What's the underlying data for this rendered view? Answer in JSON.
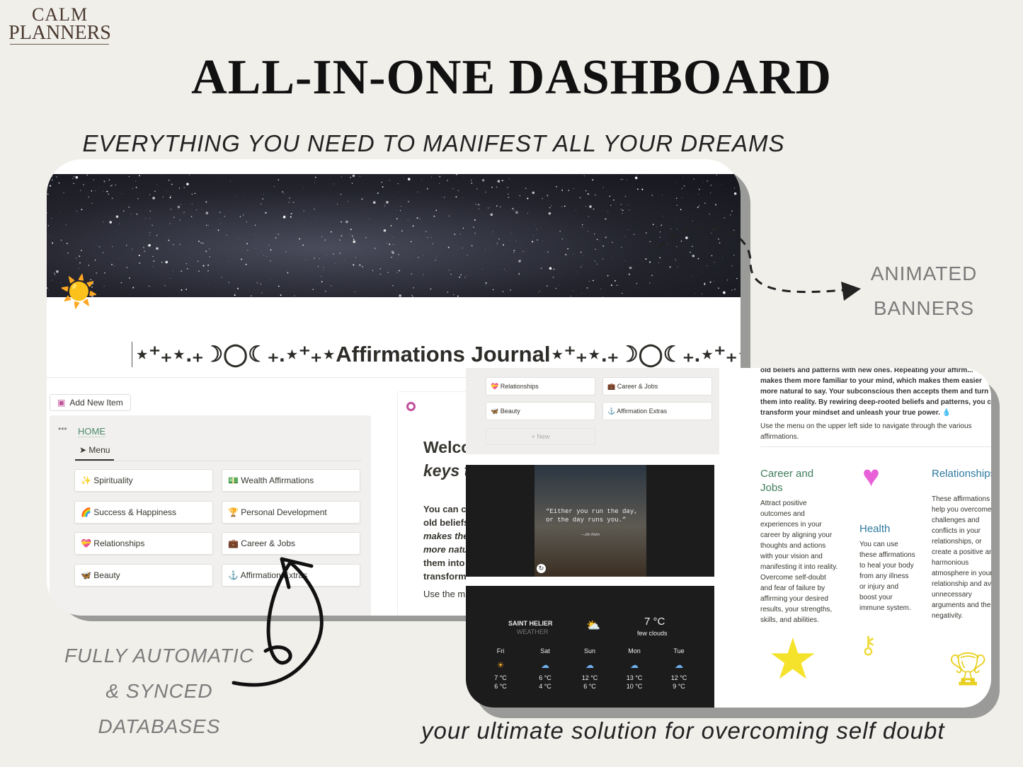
{
  "brand": {
    "line1": "CALM",
    "line2": "PLANNERS"
  },
  "header": {
    "title": "ALL-IN-ONE DASHBOARD",
    "subtitle": "EVERYTHING YOU NEED TO MANIFEST ALL YOUR DREAMS"
  },
  "annotations": {
    "animated_line1": "ANIMATED",
    "animated_line2": "BANNERS",
    "auto_line1": "FULLY AUTOMATIC",
    "auto_line2": "& SYNCED",
    "auto_line3": "DATABASES",
    "tagline": "your ultimate solution for overcoming self doubt"
  },
  "page": {
    "icon": "☀️",
    "title": "⋆⁺₊⋆.₊☽◯☾₊.⋆⁺₊⋆Affirmations Journal⋆⁺₊⋆.₊☽◯☾₊.⋆⁺₊⋆",
    "add_new_label": "Add New Item",
    "home_label": "HOME",
    "menu_tab": "Menu"
  },
  "menu": {
    "items": [
      {
        "icon": "✨",
        "label": "Spirituality"
      },
      {
        "icon": "💵",
        "label": "Wealth Affirmations"
      },
      {
        "icon": "🌈",
        "label": "Success & Happiness"
      },
      {
        "icon": "🏆",
        "label": "Personal Development"
      },
      {
        "icon": "💝",
        "label": "Relationships"
      },
      {
        "icon": "💼",
        "label": "Career & Jobs"
      },
      {
        "icon": "🦋",
        "label": "Beauty"
      },
      {
        "icon": "⚓",
        "label": "Affirmation Extras"
      }
    ],
    "new_label": "+ New"
  },
  "welcome": {
    "heading1": "Welco",
    "heading2": "keys t",
    "lines": [
      "You can c",
      "old beliefs",
      "makes the",
      "more natu",
      "them into",
      "transform",
      "Use the m"
    ]
  },
  "video": {
    "quote": "“Either you run the day, or the day runs you.”",
    "author": "—Jim Rohn"
  },
  "weather": {
    "city": "SAINT HELIER",
    "label": "WEATHER",
    "current_temp": "7 °C",
    "description": "few clouds",
    "icon": "sun-cloud",
    "forecast": [
      {
        "day": "Fri",
        "icon": "☀",
        "high": "7 °C",
        "low": "6 °C"
      },
      {
        "day": "Sat",
        "icon": "☁",
        "high": "6 °C",
        "low": "4 °C"
      },
      {
        "day": "Sun",
        "icon": "☁",
        "high": "12 °C",
        "low": "6 °C"
      },
      {
        "day": "Mon",
        "icon": "☁",
        "high": "13 °C",
        "low": "10 °C"
      },
      {
        "day": "Tue",
        "icon": "☁",
        "high": "12 °C",
        "low": "9 °C"
      }
    ]
  },
  "intro": {
    "p1": "old beliefs and patterns with new ones. Repeating your affirm... makes them more familiar to your mind, which makes them easier more natural to say. Your subconscious then accepts them and turn them into reality. By rewiring deep-rooted beliefs and patterns, you c transform your mindset and unleash your true power. 💧",
    "p2": "Use the menu on the upper left side to navigate through the various affirmations."
  },
  "sections": [
    {
      "title": "Career and Jobs",
      "color": "#3f7d5c",
      "text": "Attract positive outcomes and experiences in your career by aligning your thoughts and actions with your vision and manifesting it into reality. Overcome self-doubt and fear of failure by affirming your desired results, your strengths, skills, and abilities."
    },
    {
      "title": "Health",
      "color": "#2f7aa0",
      "text": "You can use these affirmations to heal your body from any illness or injury and boost your immune system."
    },
    {
      "title": "Relationships",
      "color": "#2f7aa0",
      "text": "These affirmations help you overcome challenges and conflicts in your relationships, or create a positive and harmonious atmosphere in your relationship and avoid unnecessary arguments and their negativity."
    }
  ]
}
